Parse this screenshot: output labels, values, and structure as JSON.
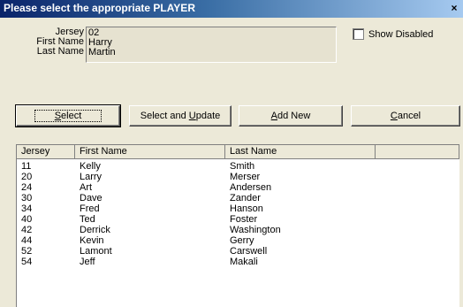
{
  "window": {
    "title": "Please select the appropriate PLAYER",
    "close_glyph": "×"
  },
  "info": {
    "labels": {
      "jersey": "Jersey",
      "first": "First Name",
      "last": "Last Name"
    },
    "values": {
      "jersey": "02",
      "first": "Harry",
      "last": "Martin"
    }
  },
  "show_disabled": {
    "label": "Show Disabled",
    "checked": false
  },
  "buttons": {
    "select": {
      "label": "Select",
      "mnemonic": "S",
      "rest": "elect"
    },
    "select_update": {
      "label": "Select and Update",
      "pre": "Select and ",
      "mnemonic": "U",
      "rest": "pdate"
    },
    "add_new": {
      "label": "Add New",
      "mnemonic": "A",
      "rest": "dd New"
    },
    "cancel": {
      "label": "Cancel",
      "mnemonic": "C",
      "rest": "ancel"
    }
  },
  "table": {
    "columns": [
      "Jersey",
      "First Name",
      "Last Name",
      ""
    ],
    "rows": [
      [
        "11",
        "Kelly",
        "Smith"
      ],
      [
        "20",
        "Larry",
        "Merser"
      ],
      [
        "24",
        "Art",
        "Andersen"
      ],
      [
        "30",
        "Dave",
        "Zander"
      ],
      [
        "34",
        "Fred",
        "Hanson"
      ],
      [
        "40",
        "Ted",
        "Foster"
      ],
      [
        "42",
        "Derrick",
        "Washington"
      ],
      [
        "44",
        "Kevin",
        "Gerry"
      ],
      [
        "52",
        "Lamont",
        "Carswell"
      ],
      [
        "54",
        "Jeff",
        "Makali"
      ]
    ]
  }
}
